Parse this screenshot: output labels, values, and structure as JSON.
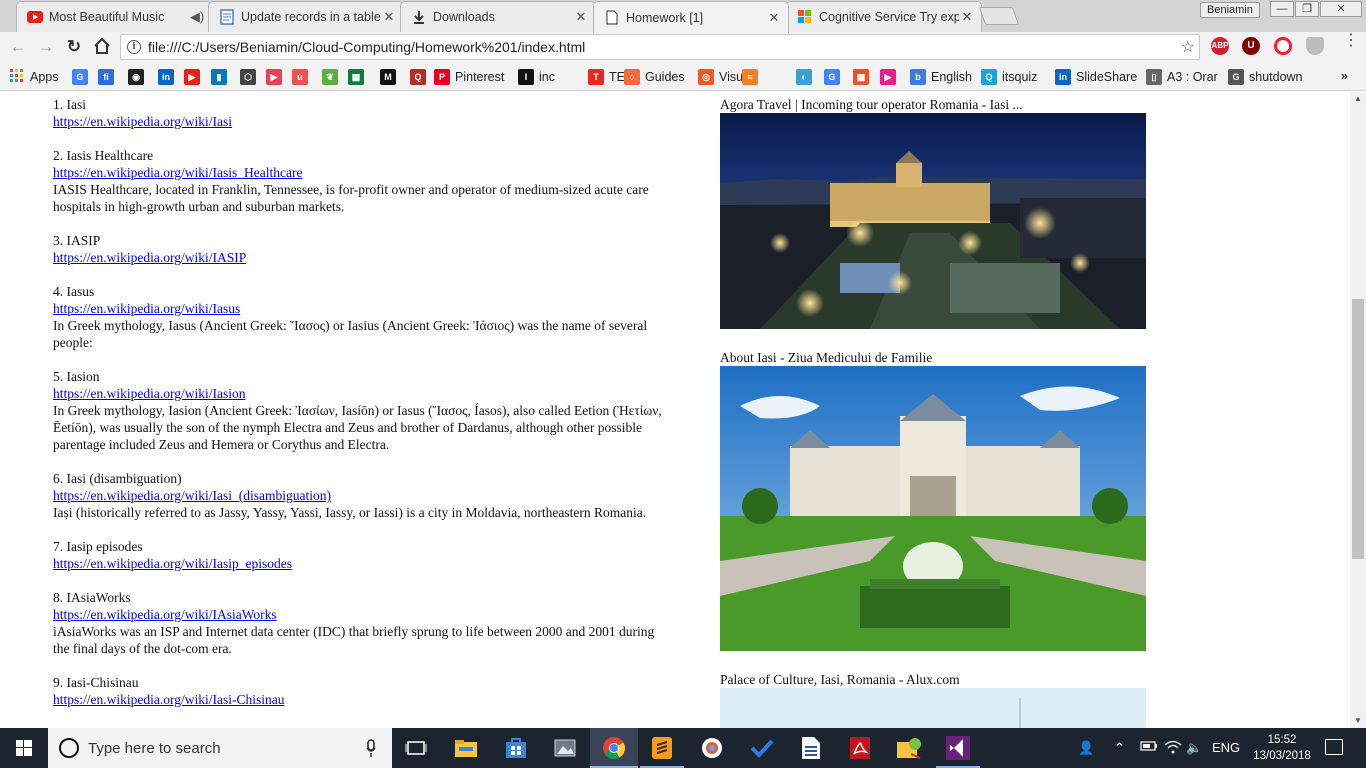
{
  "tabs": [
    {
      "title": "Most Beautiful Music",
      "favicon": "youtube-icon",
      "color": "#e62117"
    },
    {
      "title": "Update records in a table",
      "favicon": "document-icon",
      "color": "#4a7bd4"
    },
    {
      "title": "Downloads",
      "favicon": "download-icon",
      "color": "#333333"
    },
    {
      "title": "Homework [1]",
      "favicon": "page-icon",
      "color": "#555555"
    },
    {
      "title": "Cognitive Service Try exp",
      "favicon": "microsoft-icon",
      "color": "#f25022"
    }
  ],
  "window": {
    "profile": "Beniamin"
  },
  "toolbar": {
    "url": "file:///C:/Users/Beniamin/Cloud-Computing/Homework%201/index.html",
    "extensions": [
      "ABP",
      "U",
      "O",
      "shield"
    ]
  },
  "bookmarks": {
    "apps": "Apps",
    "items": [
      {
        "label": "",
        "icon": "google-icon",
        "color": "#4285f4"
      },
      {
        "label": "",
        "icon": "fi-icon",
        "color": "#2f6fd6"
      },
      {
        "label": "",
        "icon": "github-icon",
        "color": "#222222"
      },
      {
        "label": "",
        "icon": "linkedin-icon",
        "color": "#0a66c2"
      },
      {
        "label": "",
        "icon": "youtube-icon",
        "color": "#e62117"
      },
      {
        "label": "",
        "icon": "trello-icon",
        "color": "#0079bf"
      },
      {
        "label": "",
        "icon": "codepen-icon",
        "color": "#444444"
      },
      {
        "label": "",
        "icon": "play-icon",
        "color": "#e9415b"
      },
      {
        "label": "",
        "icon": "udemy-icon",
        "color": "#ec5252"
      },
      {
        "label": "",
        "icon": "leaf-icon",
        "color": "#5cae3f"
      },
      {
        "label": "",
        "icon": "grid-icon",
        "color": "#117a3d"
      },
      {
        "label": "",
        "icon": "medium-icon",
        "color": "#111111"
      },
      {
        "label": "",
        "icon": "quora-icon",
        "color": "#b92b27"
      },
      {
        "label": "Pinterest",
        "icon": "pinterest-icon",
        "color": "#e60023"
      },
      {
        "label": "inc",
        "icon": "inc-icon",
        "color": "#111111"
      },
      {
        "label": "TED",
        "icon": "ted-icon",
        "color": "#e62b1e"
      },
      {
        "label": "Guides",
        "icon": "bulb-icon",
        "color": "#f26b3a"
      },
      {
        "label": "Visual",
        "icon": "target-icon",
        "color": "#ee5a24"
      },
      {
        "label": "",
        "icon": "stack-icon",
        "color": "#f48024"
      },
      {
        "label": "",
        "icon": "bird-icon",
        "color": "#3aa0d6"
      },
      {
        "label": "",
        "icon": "google-icon-2",
        "color": "#4285f4"
      },
      {
        "label": "",
        "icon": "windows-icon",
        "color": "#f25022"
      },
      {
        "label": "",
        "icon": "media-icon",
        "color": "#e91e8c"
      },
      {
        "label": "English",
        "icon": "b-icon",
        "color": "#3b7ddd"
      },
      {
        "label": "itsquiz",
        "icon": "quiz-icon",
        "color": "#1aa5d8"
      },
      {
        "label": "SlideShare",
        "icon": "linkedin-icon-2",
        "color": "#0a66c2"
      },
      {
        "label": "A3 : Orar",
        "icon": "page-icon",
        "color": "#666666"
      },
      {
        "label": "shutdown",
        "icon": "gi-icon",
        "color": "#555555"
      }
    ]
  },
  "results": [
    {
      "title": "1. Iasi",
      "url": "https://en.wikipedia.org/wiki/Iasi",
      "desc": ""
    },
    {
      "title": "2. Iasis Healthcare",
      "url": "https://en.wikipedia.org/wiki/Iasis_Healthcare",
      "desc": "IASIS Healthcare, located in Franklin, Tennessee, is for-profit owner and operator of medium-sized acute care hospitals in high-growth urban and suburban markets."
    },
    {
      "title": "3. IASIP",
      "url": "https://en.wikipedia.org/wiki/IASIP",
      "desc": ""
    },
    {
      "title": "4. Iasus",
      "url": "https://en.wikipedia.org/wiki/Iasus",
      "desc": "In Greek mythology, Iasus (Ancient Greek: Ἴασος) or Iasius (Ancient Greek: Ἰάσιος) was the name of several people:"
    },
    {
      "title": "5. Iasion",
      "url": "https://en.wikipedia.org/wiki/Iasion",
      "desc": "In Greek mythology, Iasion (Ancient Greek: Ἰασίων, Iasíōn) or Iasus (Ἴασος, Íasos), also called Eetion (Ἠετίων, Ēetíōn), was usually the son of the nymph Electra and Zeus and brother of Dardanus, although other possible parentage included Zeus and Hemera or Corythus and Electra."
    },
    {
      "title": "6. Iasi (disambiguation)",
      "url": "https://en.wikipedia.org/wiki/Iasi_(disambiguation)",
      "desc": "Iași (historically referred to as Jassy, Yassy, Yassi, Iassy, or Iassi) is a city in Moldavia, northeastern Romania."
    },
    {
      "title": "7. Iasip episodes",
      "url": "https://en.wikipedia.org/wiki/Iasip_episodes",
      "desc": ""
    },
    {
      "title": "8. IAsiaWorks",
      "url": "https://en.wikipedia.org/wiki/IAsiaWorks",
      "desc": "iAsiaWorks was an ISP and Internet data center (IDC) that briefly sprung to life between 2000 and 2001 during the final days of the dot-com era."
    },
    {
      "title": "9. Iasi-Chisinau",
      "url": "https://en.wikipedia.org/wiki/Iasi-Chisinau",
      "desc": ""
    }
  ],
  "images": [
    {
      "caption": "Agora Travel | Incoming tour operator Romania - Iasi ...",
      "scene": "night"
    },
    {
      "caption": "About Iasi - Ziua Medicului de Familie",
      "scene": "day"
    },
    {
      "caption": "Palace of Culture, Iasi, Romania - Alux.com",
      "scene": "sky"
    }
  ],
  "taskbar": {
    "search_placeholder": "Type here to search",
    "language": "ENG",
    "time": "15:52",
    "date": "13/03/2018"
  }
}
